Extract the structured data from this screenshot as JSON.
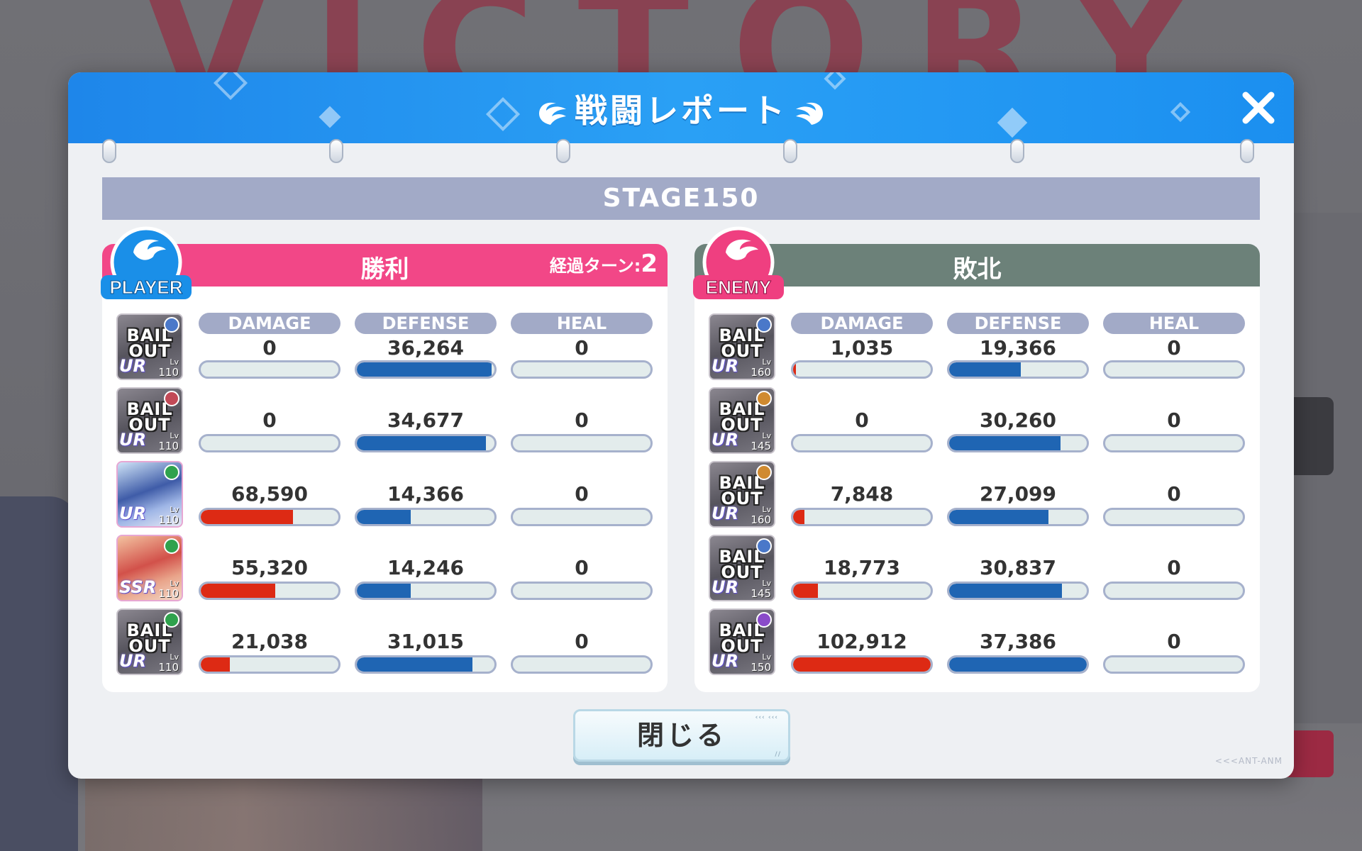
{
  "background": {
    "victory_text": "VICTORY"
  },
  "modal": {
    "title": "戦闘レポート",
    "close_icon": "close-icon",
    "stage": "STAGE150",
    "close_button": "閉じる",
    "footer_logo": "<<<ANT-ANM"
  },
  "player": {
    "badge": "PLAYER",
    "result": "勝利",
    "turns_label": "経過ターン:",
    "turns_value": "2",
    "labels": {
      "damage": "DAMAGE",
      "defense": "DEFENSE",
      "heal": "HEAL"
    },
    "units": [
      {
        "avatar": "BAIL OUT",
        "rarity": "UR",
        "level": "110",
        "damage": "0",
        "defense": "36,264",
        "heal": "0",
        "damage_ratio": 0.0,
        "defense_ratio": 0.98,
        "heal_ratio": 0.0,
        "mark_color": "#4a78c9"
      },
      {
        "avatar": "BAIL OUT",
        "rarity": "UR",
        "level": "110",
        "damage": "0",
        "defense": "34,677",
        "heal": "0",
        "damage_ratio": 0.0,
        "defense_ratio": 0.94,
        "heal_ratio": 0.0,
        "mark_color": "#c24a57"
      },
      {
        "avatar": "",
        "rarity": "UR",
        "level": "110",
        "damage": "68,590",
        "defense": "14,366",
        "heal": "0",
        "damage_ratio": 0.67,
        "defense_ratio": 0.39,
        "heal_ratio": 0.0,
        "mark_color": "#2fa24d",
        "portrait": "blue-hair"
      },
      {
        "avatar": "",
        "rarity": "SSR",
        "level": "110",
        "damage": "55,320",
        "defense": "14,246",
        "heal": "0",
        "damage_ratio": 0.54,
        "defense_ratio": 0.39,
        "heal_ratio": 0.0,
        "mark_color": "#2fa24d",
        "portrait": "red-hair"
      },
      {
        "avatar": "BAIL OUT",
        "rarity": "UR",
        "level": "110",
        "damage": "21,038",
        "defense": "31,015",
        "heal": "0",
        "damage_ratio": 0.21,
        "defense_ratio": 0.84,
        "heal_ratio": 0.0,
        "mark_color": "#2fa24d"
      }
    ]
  },
  "enemy": {
    "badge": "ENEMY",
    "result": "敗北",
    "labels": {
      "damage": "DAMAGE",
      "defense": "DEFENSE",
      "heal": "HEAL"
    },
    "units": [
      {
        "avatar": "BAIL OUT",
        "rarity": "UR",
        "level": "160",
        "damage": "1,035",
        "defense": "19,366",
        "heal": "0",
        "damage_ratio": 0.02,
        "defense_ratio": 0.52,
        "heal_ratio": 0.0,
        "mark_color": "#4a78c9"
      },
      {
        "avatar": "BAIL OUT",
        "rarity": "UR",
        "level": "145",
        "damage": "0",
        "defense": "30,260",
        "heal": "0",
        "damage_ratio": 0.0,
        "defense_ratio": 0.81,
        "heal_ratio": 0.0,
        "mark_color": "#d08a30"
      },
      {
        "avatar": "BAIL OUT",
        "rarity": "UR",
        "level": "160",
        "damage": "7,848",
        "defense": "27,099",
        "heal": "0",
        "damage_ratio": 0.08,
        "defense_ratio": 0.72,
        "heal_ratio": 0.0,
        "mark_color": "#d08a30"
      },
      {
        "avatar": "BAIL OUT",
        "rarity": "UR",
        "level": "145",
        "damage": "18,773",
        "defense": "30,837",
        "heal": "0",
        "damage_ratio": 0.18,
        "defense_ratio": 0.82,
        "heal_ratio": 0.0,
        "mark_color": "#4a78c9"
      },
      {
        "avatar": "BAIL OUT",
        "rarity": "UR",
        "level": "150",
        "damage": "102,912",
        "defense": "37,386",
        "heal": "0",
        "damage_ratio": 1.0,
        "defense_ratio": 1.0,
        "heal_ratio": 0.0,
        "mark_color": "#8a4ac9"
      }
    ]
  }
}
